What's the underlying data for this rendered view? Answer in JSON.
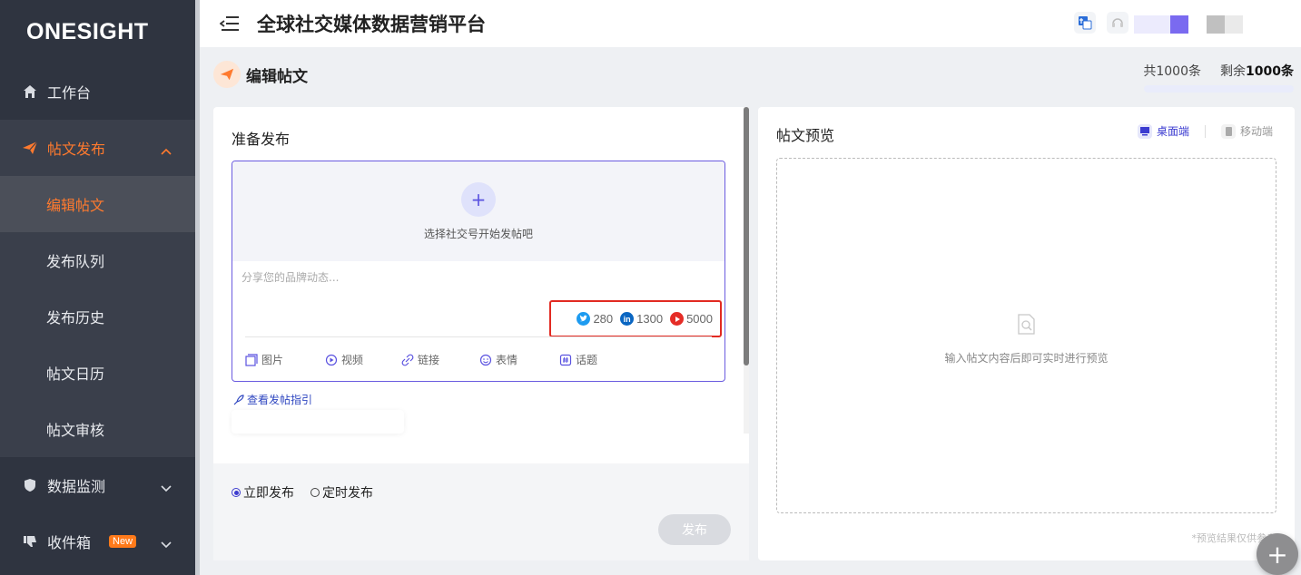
{
  "sidebar": {
    "logo": "ONESIGHT",
    "items": [
      {
        "label": "工作台",
        "icon": "home-icon"
      },
      {
        "label": "帖文发布",
        "icon": "send-icon",
        "expanded": true
      },
      {
        "label": "数据监测",
        "icon": "shield-icon"
      },
      {
        "label": "收件箱",
        "icon": "thumbs-down-icon",
        "badge": "New"
      }
    ],
    "subitems": [
      {
        "label": "编辑帖文",
        "active": true
      },
      {
        "label": "发布队列"
      },
      {
        "label": "发布历史"
      },
      {
        "label": "帖文日历"
      },
      {
        "label": "帖文审核"
      }
    ]
  },
  "header": {
    "app_title": "全球社交媒体数据营销平台"
  },
  "page": {
    "title": "编辑帖文",
    "total": "共1000条",
    "remaining_prefix": "剩余",
    "remaining_value": "1000条"
  },
  "composer": {
    "section_title": "准备发布",
    "select_account_hint": "选择社交号开始发帖吧",
    "placeholder": "分享您的品牌动态...",
    "char_limits": [
      {
        "platform": "twitter",
        "value": "280",
        "color": "#1d9bf0"
      },
      {
        "platform": "linkedin",
        "value": "1300",
        "color": "#0a66c2"
      },
      {
        "platform": "youtube",
        "value": "5000",
        "color": "#e52d27"
      }
    ],
    "tools": [
      "图片",
      "视频",
      "链接",
      "表情",
      "话题"
    ],
    "guide_link": "查看发帖指引",
    "publish_now": "立即发布",
    "publish_scheduled": "定时发布",
    "publish_button": "发布"
  },
  "preview": {
    "title": "帖文预览",
    "desktop": "桌面端",
    "mobile": "移动端",
    "empty_hint": "输入帖文内容后即可实时进行预览",
    "note": "*预览结果仅供参考"
  },
  "colors": {
    "sidebar_bg": "#2f3440",
    "accent": "#ff7a2e",
    "primary": "#5a52e0",
    "highlight_border": "#e22a22"
  }
}
